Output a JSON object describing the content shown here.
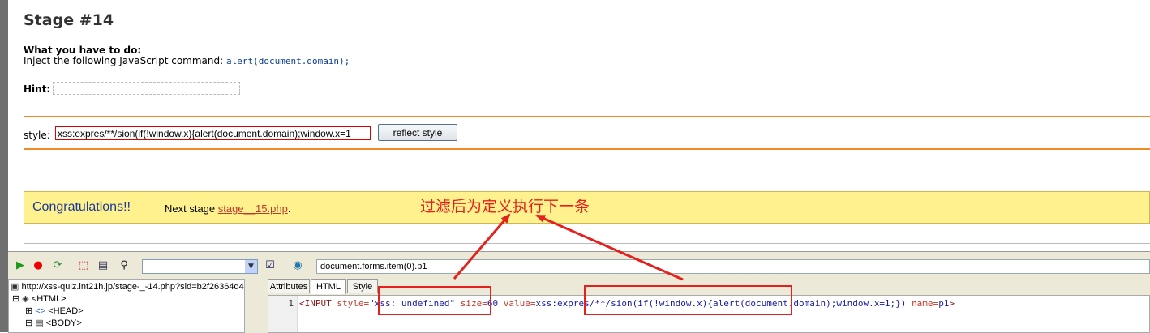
{
  "page": {
    "title": "Stage #14",
    "todo_heading": "What you have to do:",
    "todo_prefix": "Inject the following JavaScript command:",
    "todo_command": "alert(document.domain);",
    "hint_label": "Hint:",
    "style_label": "style:",
    "style_value": "xss:expres/**/sion(if(!window.x){alert(document.domain);window.x=1",
    "reflect_button": "reflect style",
    "congrats": "Congratulations!!",
    "next_stage_label": "Next stage",
    "next_stage_link": "stage__15.php",
    "next_stage_suffix": "."
  },
  "annotation": {
    "text": "过滤后为定义执行下一条",
    "color": "#e4211c"
  },
  "devtools": {
    "toolbar_icons": [
      "run-icon",
      "stop-icon",
      "refresh-icon",
      "select-element-icon",
      "dom-icon",
      "find-icon"
    ],
    "search_value": "",
    "path_value": "document.forms.item(0).p1",
    "tree": {
      "url": "http://xss-quiz.int21h.jp/stage-_-14.php?sid=b2f26364d4",
      "html": "<HTML>",
      "head": "<HEAD>",
      "body": "<BODY>"
    },
    "tabs": [
      "Attributes",
      "HTML",
      "Style"
    ],
    "active_tab": "HTML",
    "code": {
      "line_number": "1",
      "tag_open": "<INPUT",
      "style_attr": "style=",
      "style_value": "\"xss: undefined\"",
      "size_attr": "size=",
      "size_value": "60",
      "value_attr": "value=",
      "value_value_a": "xss:expres/**/sion(if(!window.x)",
      "value_value_b": "{alert(document.domain);window.x=1;})",
      "name_attr": "name=",
      "name_value": "p1",
      "tag_close": ">"
    }
  }
}
